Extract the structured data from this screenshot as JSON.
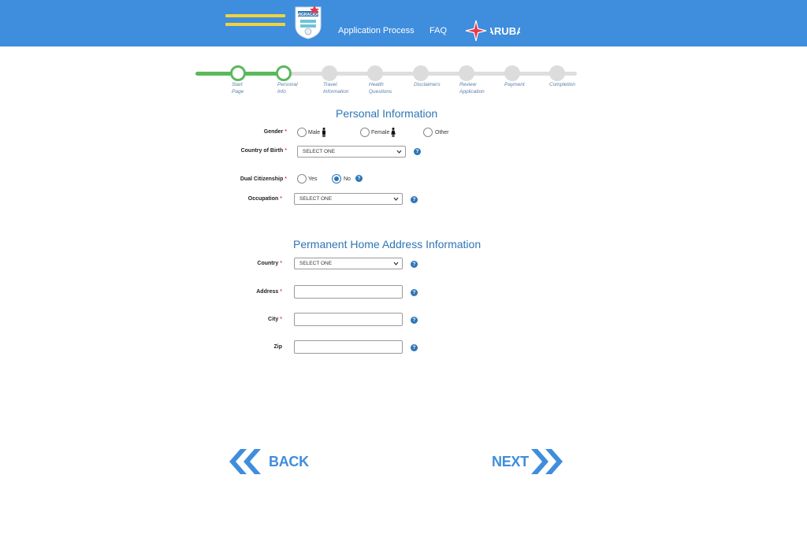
{
  "header": {
    "logo_text": "MIGRACION",
    "nav": {
      "application_process": "Application Process",
      "faq": "FAQ"
    },
    "brand": "ARUBA",
    "colors": {
      "bar": "#3f8ddd",
      "menu_stripes": "#f2d23a",
      "star": "#e63946"
    }
  },
  "progress": {
    "completed_steps": 2,
    "steps": [
      {
        "line1": "Start",
        "line2": "Page"
      },
      {
        "line1": "Personal",
        "line2": "Info"
      },
      {
        "line1": "Travel",
        "line2": "Information"
      },
      {
        "line1": "Health",
        "line2": "Questions"
      },
      {
        "line1": "Disclaimers",
        "line2": ""
      },
      {
        "line1": "Review",
        "line2": "Application"
      },
      {
        "line1": "Payment",
        "line2": ""
      },
      {
        "line1": "Completion",
        "line2": ""
      }
    ]
  },
  "personal": {
    "title": "Personal Information",
    "gender": {
      "label": "Gender",
      "options": {
        "male": "Male",
        "female": "Female",
        "other": "Other"
      },
      "selected": ""
    },
    "country_of_birth": {
      "label": "Country of Birth",
      "value": "SELECT ONE"
    },
    "dual_citizenship": {
      "label": "Dual Citizenship",
      "options": {
        "yes": "Yes",
        "no": "No"
      },
      "selected": "No"
    },
    "occupation": {
      "label": "Occupation",
      "value": "SELECT ONE"
    }
  },
  "address": {
    "title": "Permanent Home Address Information",
    "country": {
      "label": "Country",
      "value": "SELECT ONE"
    },
    "address": {
      "label": "Address",
      "value": ""
    },
    "city": {
      "label": "City",
      "value": ""
    },
    "zip": {
      "label": "Zip",
      "value": ""
    }
  },
  "required_mark": "*",
  "help_glyph": "?",
  "buttons": {
    "back": "BACK",
    "next": "NEXT"
  },
  "colors": {
    "accent": "#2e75b6",
    "progress_done": "#5cb85c",
    "required": "#d9534f"
  }
}
